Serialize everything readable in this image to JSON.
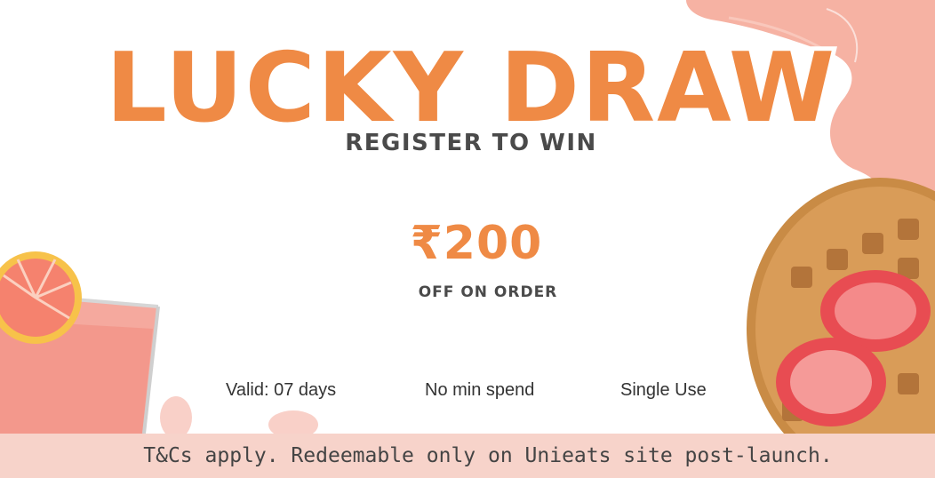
{
  "banner": {
    "title": "LUCKY DRAW",
    "subtitle": "REGISTER TO WIN",
    "amount": "₹200",
    "amount_label": "OFF ON ORDER",
    "features": [
      "Valid: 07 days",
      "No min spend",
      "Single Use"
    ],
    "footer": "T&Cs apply. Redeemable only on Unieats site post-launch."
  },
  "icons": [
    "pink-drink-glass-icon",
    "waffle-with-strawberries-icon",
    "pink-splash-icon"
  ],
  "colors": {
    "accent": "#ef8a45",
    "text_dark": "#4a4a4a",
    "splash": "#f6b2a3",
    "footer_bg": "#f7d3ca"
  }
}
